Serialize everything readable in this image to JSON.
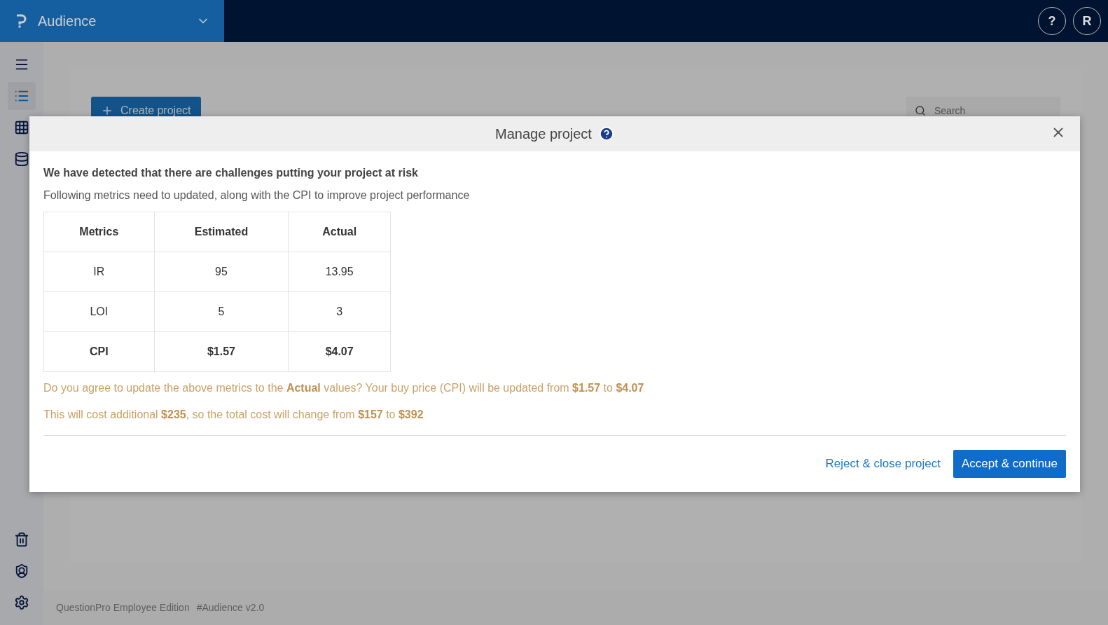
{
  "header": {
    "product": "Audience",
    "help": "?",
    "avatar": "R"
  },
  "sidebar": {
    "items": [
      {
        "selected": false
      },
      {
        "selected": true
      },
      {
        "selected": false
      },
      {
        "selected": false
      }
    ],
    "bottom_items": [
      {
        "selected": false
      },
      {
        "selected": false
      },
      {
        "selected": false
      }
    ]
  },
  "page": {
    "create_button": "Create project",
    "search": {
      "placeholder": "Search"
    }
  },
  "footer": {
    "edition": "QuestionPro Employee Edition",
    "version": "#Audience v2.0"
  },
  "modal": {
    "title": "Manage project",
    "heading": "We have detected that there are challenges putting your project at risk",
    "intro": "Following metrics need to updated, along with the CPI to improve project performance",
    "table": {
      "columns": [
        "Metrics",
        "Estimated",
        "Actual"
      ],
      "rows": [
        {
          "cells": [
            "IR",
            "95",
            "13.95"
          ],
          "emphasis": false
        },
        {
          "cells": [
            "LOI",
            "5",
            "3"
          ],
          "emphasis": false
        },
        {
          "cells": [
            "CPI",
            "$1.57",
            "$4.07"
          ],
          "emphasis": true
        }
      ]
    },
    "notes": [
      "Do you agree to update the above metrics to the **Actual** values? Your buy price (CPI) will be updated from **$1.57** to **$4.07**",
      "This will cost additional **$235**, so the total cost will change from **$157** to **$392**"
    ],
    "reject": "Reject & close project",
    "accept": "Accept & continue"
  }
}
